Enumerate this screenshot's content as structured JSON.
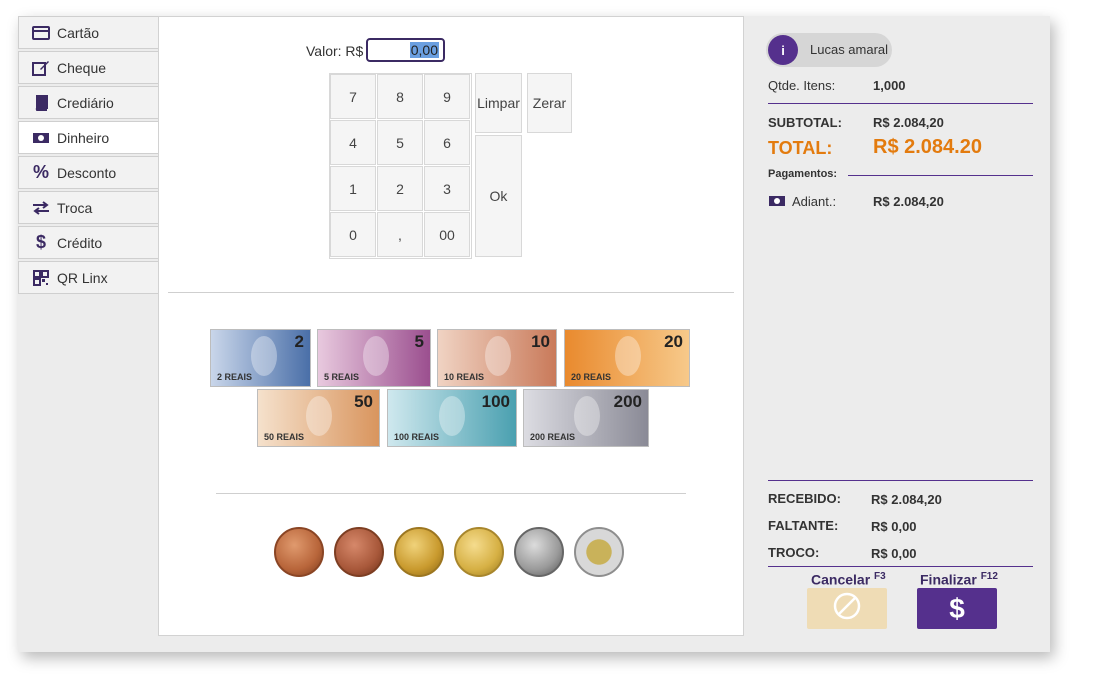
{
  "sidebar": {
    "items": [
      {
        "label": "Cartão",
        "icon": "card-icon"
      },
      {
        "label": "Cheque",
        "icon": "edit-icon"
      },
      {
        "label": "Crediário",
        "icon": "book-icon"
      },
      {
        "label": "Dinheiro",
        "icon": "cash-icon"
      },
      {
        "label": "Desconto",
        "icon": "percent-icon"
      },
      {
        "label": "Troca",
        "icon": "swap-icon"
      },
      {
        "label": "Crédito",
        "icon": "dollar-icon"
      },
      {
        "label": "QR Linx",
        "icon": "qr-icon"
      }
    ],
    "active": "Dinheiro"
  },
  "payment": {
    "valor_label": "Valor: R$",
    "valor_value": "0,00"
  },
  "keypad": {
    "keys": [
      "7",
      "8",
      "9",
      "4",
      "5",
      "6",
      "1",
      "2",
      "3",
      "0",
      ",",
      "00"
    ],
    "limpar": "Limpar",
    "zerar": "Zerar",
    "ok": "Ok"
  },
  "banknotes": [
    {
      "value": "2",
      "small": "2 REAIS",
      "color": "#4a6fa8"
    },
    {
      "value": "5",
      "small": "5 REAIS",
      "color": "#9b4f8f"
    },
    {
      "value": "10",
      "small": "10 REAIS",
      "color": "#c97a5a"
    },
    {
      "value": "20",
      "small": "20 REAIS",
      "color": "#e98a2e"
    },
    {
      "value": "50",
      "small": "50 REAIS",
      "color": "#d9955e"
    },
    {
      "value": "100",
      "small": "100 REAIS",
      "color": "#4aa0b0"
    },
    {
      "value": "200",
      "small": "200 REAIS",
      "color": "#8a8a96"
    }
  ],
  "coins": [
    {
      "name": "coin-1-centavo",
      "color": "#b8653a"
    },
    {
      "name": "coin-5-centavos",
      "color": "#a8583a"
    },
    {
      "name": "coin-10-centavos",
      "color": "#c99a2e"
    },
    {
      "name": "coin-25-centavos",
      "color": "#d6b044"
    },
    {
      "name": "coin-50-centavos",
      "color": "#9a9a9a"
    },
    {
      "name": "coin-1-real",
      "color": "#c9b25a"
    }
  ],
  "user": {
    "name": "Lucas amaral"
  },
  "summary": {
    "qtde_label": "Qtde. Itens:",
    "qtde_value": "1,000",
    "subtotal_label": "SUBTOTAL:",
    "subtotal_value": "R$ 2.084,20",
    "total_label": "TOTAL:",
    "total_value": "R$ 2.084.20",
    "pagamentos_label": "Pagamentos:",
    "adiant_label": "Adiant.:",
    "adiant_value": "R$ 2.084,20",
    "recebido_label": "RECEBIDO:",
    "recebido_value": "R$ 2.084,20",
    "faltante_label": "FALTANTE:",
    "faltante_value": "R$ 0,00",
    "troco_label": "TROCO:",
    "troco_value": "R$ 0,00"
  },
  "actions": {
    "cancelar": "Cancelar",
    "cancelar_key": "F3",
    "finalizar": "Finalizar",
    "finalizar_key": "F12"
  },
  "colors": {
    "accent": "#55308d",
    "total": "#e37b0e",
    "cancel_bg": "#efdcb5"
  }
}
